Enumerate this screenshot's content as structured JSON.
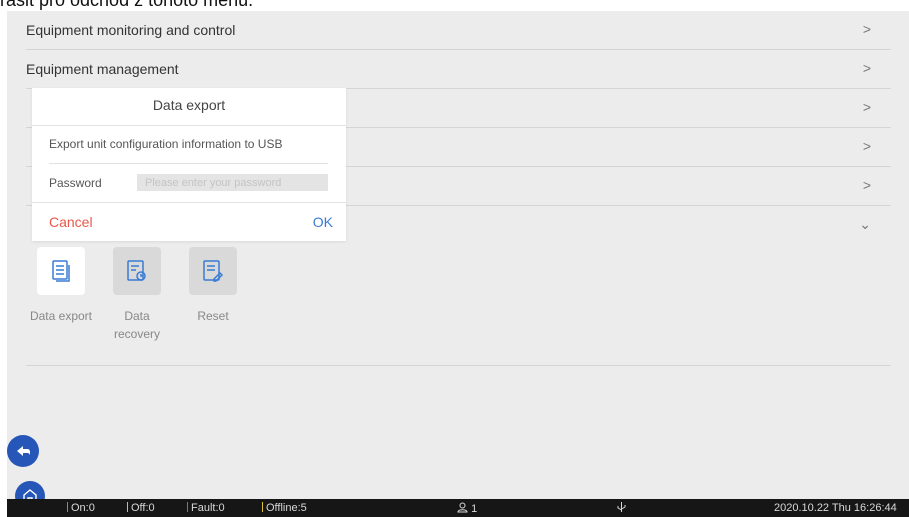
{
  "doc_text": "rasit  pro odchod z tohoto menu.",
  "menu": {
    "rows": [
      {
        "label": "Equipment monitoring and control",
        "arrow": ">"
      },
      {
        "label": "Equipment management",
        "arrow": ">"
      },
      {
        "label": "",
        "arrow": ">"
      },
      {
        "label": "",
        "arrow": ">"
      },
      {
        "label": "",
        "arrow": ">"
      },
      {
        "label": "",
        "arrow": "⌄"
      }
    ]
  },
  "tiles": [
    {
      "label": "Data export",
      "icon": "document-export-icon"
    },
    {
      "label": "Data recovery",
      "icon": "document-recovery-icon"
    },
    {
      "label": "Reset",
      "icon": "document-reset-icon"
    }
  ],
  "dialog": {
    "title": "Data export",
    "description": "Export unit configuration information to USB",
    "password_label": "Password",
    "password_placeholder": "Please enter your password",
    "cancel_label": "Cancel",
    "ok_label": "OK"
  },
  "statusbar": {
    "on": "On:0",
    "off": "Off:0",
    "fault": "Fault:0",
    "offline": "Offline:5",
    "users": "1",
    "datetime": "2020.10.22  Thu  16:26:44"
  },
  "colors": {
    "on": "#3fbf3f",
    "off": "#bbbbbb",
    "fault": "#e84a4a",
    "offline": "#e0c23a",
    "primary": "#2556b8",
    "cancel": "#e8584a",
    "ok": "#3a7bd5"
  }
}
